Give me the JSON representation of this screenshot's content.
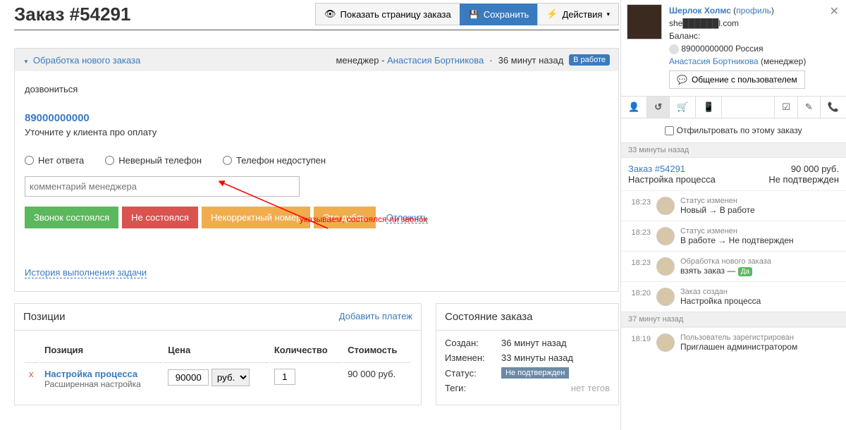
{
  "header": {
    "title": "Заказ #54291",
    "show_page": "Показать страницу заказа",
    "save": "Сохранить",
    "actions": "Действия"
  },
  "task": {
    "title": "Обработка нового заказа",
    "manager_label": "менеджер - ",
    "manager": "Анастасия Бортникова",
    "time": "36 минут назад",
    "status": "В работе",
    "reach": "дозвониться",
    "phone": "89000000000",
    "instruction": "Уточните у клиента про оплату",
    "radios": [
      "Нет ответа",
      "Неверный телефон",
      "Телефон недоступен"
    ],
    "comment_placeholder": "комментарий менеджера",
    "btn_ok": "Звонок состоялся",
    "btn_fail": "Не состоялся",
    "btn_wrong": "Некорректный номер",
    "btn_dup": "Это дубль",
    "postpone": "Отложить",
    "history": "История выполнения задачи"
  },
  "annotation": "указываем, состоялся ли звонок",
  "positions": {
    "title": "Позиции",
    "add": "Добавить платеж",
    "cols": [
      "Позиция",
      "Цена",
      "Количество",
      "Стоимость"
    ],
    "item": {
      "name": "Настройка процесса",
      "sub": "Расширенная настройка",
      "price": "90000",
      "currency": "руб.",
      "qty": "1",
      "total": "90 000 руб."
    }
  },
  "state": {
    "title": "Состояние заказа",
    "created_l": "Создан:",
    "created_v": "36 минут назад",
    "changed_l": "Изменен:",
    "changed_v": "33 минуты назад",
    "status_l": "Статус:",
    "status_v": "Не подтвержден",
    "tags_l": "Теги:",
    "tags_v": "нет тегов"
  },
  "side": {
    "user": "Шерлок Холмс",
    "profile": "профиль",
    "email": "she██████l.com",
    "balance_l": "Баланс:",
    "phone": "89000000000 Россия",
    "manager": "Анастасия Бортникова",
    "manager_role": "(менеджер)",
    "chat": "Общение с пользователем",
    "filter": "Отфильтровать по этому заказу",
    "sep1": "33 минуты назад",
    "summary": {
      "order": "Заказ #54291",
      "amount": "90 000 руб.",
      "name": "Настройка процесса",
      "status": "Не подтвержден"
    },
    "events": [
      {
        "time": "18:23",
        "small": "Статус изменен",
        "text": "Новый → В работе"
      },
      {
        "time": "18:23",
        "small": "Статус изменен",
        "text": "В работе → Не подтвержден"
      },
      {
        "time": "18:23",
        "small": "Обработка нового заказа",
        "text": "взять заказ — ",
        "badge": "Да"
      },
      {
        "time": "18:20",
        "small": "Заказ создан",
        "text": "Настройка процесса"
      }
    ],
    "sep2": "37 минут назад",
    "event5": {
      "time": "18:19",
      "small": "Пользователь зарегистрирован",
      "text": "Приглашен администратором"
    }
  }
}
